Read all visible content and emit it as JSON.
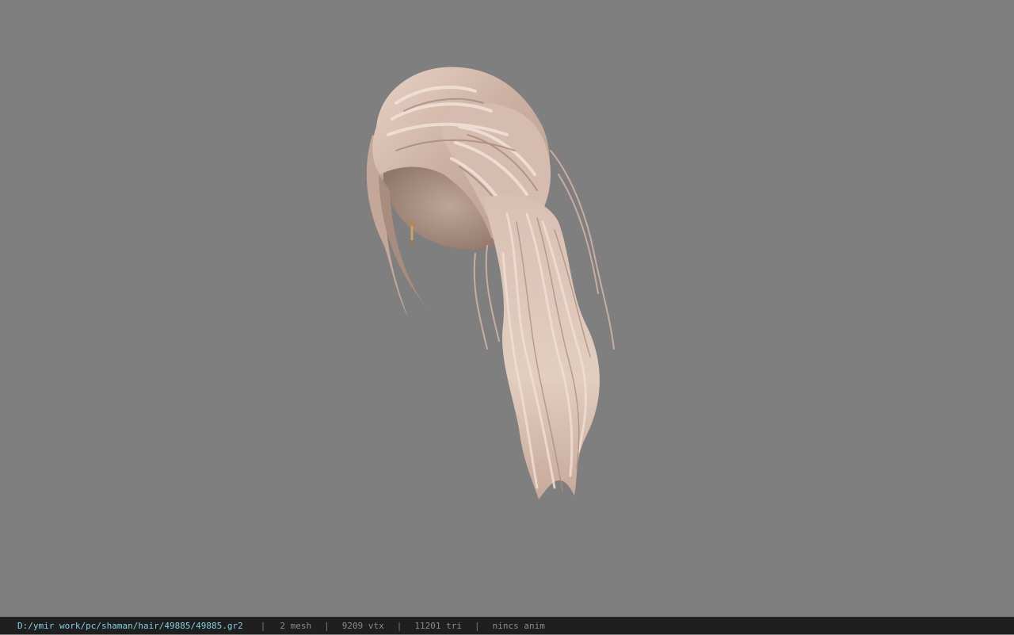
{
  "viewport": {
    "background": "#7f7f7f",
    "model": {
      "subject": "hair-model",
      "hair_color": "#d9c1b4",
      "accessory_color": "#b08a4a"
    }
  },
  "status_bar": {
    "file_path": "D:/ymir work/pc/shaman/hair/49885/49885.gr2",
    "separator": "|",
    "mesh_count": "2 mesh",
    "vertex_count": "9209 vtx",
    "triangle_count": "11201 tri",
    "animation": "nincs anim",
    "colors": {
      "background": "#1f1f1f",
      "path": "#7fd0e0",
      "text": "#8a8a8a"
    }
  }
}
